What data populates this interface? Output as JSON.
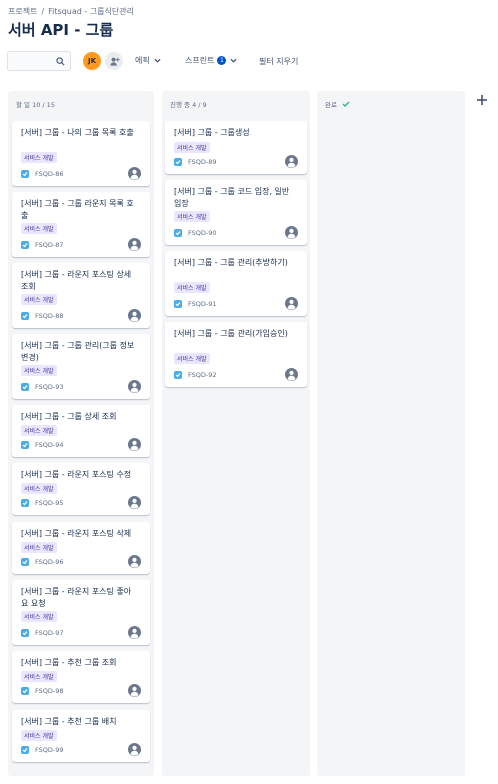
{
  "breadcrumb": {
    "root": "프로젝트",
    "separator": "/",
    "project": "Fitsquad - 그룹식단관리"
  },
  "page_title": "서버 API - 그룹",
  "toolbar": {
    "avatar_initials": "JK",
    "epic_label": "에픽",
    "sprint_label": "스프린트",
    "sprint_count": "1",
    "clear_filters": "필터 지우기"
  },
  "columns": [
    {
      "title": "할 일 10 / 15",
      "cards": [
        {
          "title": "[서버] 그룹 - 나의 그룹 목록 호출",
          "label": "서비스 개발",
          "key": "FSQD-86"
        },
        {
          "title": "[서버] 그룹 - 그룹 라운지 목록 호출",
          "label": "서비스 개발",
          "key": "FSQD-87"
        },
        {
          "title": "[서버] 그룹 - 라운지 포스팅 상세조회",
          "label": "서비스 개발",
          "key": "FSQD-88"
        },
        {
          "title": "[서버] 그룹 - 그룹 관리(그룹 정보 변경)",
          "label": "서비스 개발",
          "key": "FSQD-93"
        },
        {
          "title": "[서버] 그룹 - 그룹 상세 조회",
          "label": "서비스 개발",
          "key": "FSQD-94"
        },
        {
          "title": "[서버] 그룹 - 라운지 포스팅 수정",
          "label": "서비스 개발",
          "key": "FSQD-95"
        },
        {
          "title": "[서버] 그룹 - 라운지 포스팅 삭제",
          "label": "서비스 개발",
          "key": "FSQD-96"
        },
        {
          "title": "[서버] 그룹 - 라운지 포스팅 좋아요 요청",
          "label": "서비스 개발",
          "key": "FSQD-97"
        },
        {
          "title": "[서버] 그룹 - 추천 그룹 조회",
          "label": "서비스 개발",
          "key": "FSQD-98"
        },
        {
          "title": "[서버] 그룹 - 추천 그룹 배치",
          "label": "서비스 개발",
          "key": "FSQD-99"
        }
      ]
    },
    {
      "title": "진행 중 4 / 9",
      "cards": [
        {
          "title": "[서버] 그룹 - 그룹생성",
          "label": "서비스 개발",
          "key": "FSQD-89"
        },
        {
          "title": "[서버] 그룹 - 그룹 코드 입장, 일반 입장",
          "label": "서비스 개발",
          "key": "FSQD-90"
        },
        {
          "title": "[서버] 그룹 - 그룹 관리(추방하기)",
          "label": "서비스 개발",
          "key": "FSQD-91"
        },
        {
          "title": "[서버] 그룹 - 그룹 관리(가입승인)",
          "label": "서비스 개발",
          "key": "FSQD-92"
        }
      ]
    },
    {
      "title": "완료",
      "cards": []
    }
  ]
}
